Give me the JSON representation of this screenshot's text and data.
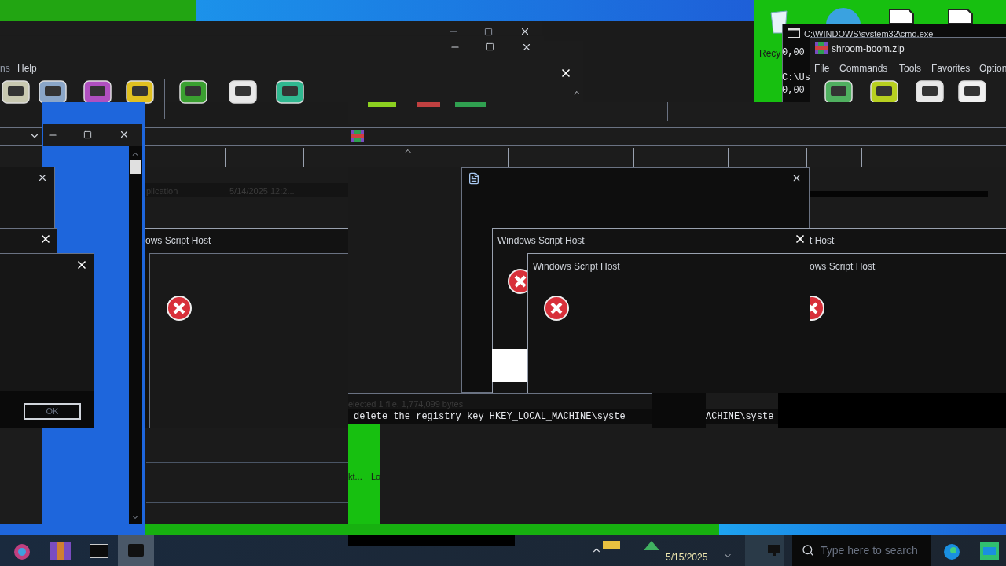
{
  "main_window": {
    "menu": [
      "ns",
      "Help"
    ]
  },
  "desktop_icons": [
    {
      "label": "Recy"
    }
  ],
  "cmd_window": {
    "title": "C:\\WINDOWS\\system32\\cmd.exe",
    "lines": [
      "0,00",
      "C:\\Us",
      "0,00"
    ]
  },
  "archive_window": {
    "title": "shroom-boom.zip",
    "menu": [
      "File",
      "Commands",
      "Tools",
      "Favorites",
      "Option"
    ]
  },
  "file_row": {
    "cells": [
      "plication",
      "5/14/2025 12:2..."
    ]
  },
  "dialogs": [
    {
      "title": "ows Script Host"
    },
    {
      "title": "Windows Script Host"
    },
    {
      "title": "Windows Script Host"
    },
    {
      "title": "t Host"
    },
    {
      "title": "ows Script Host"
    }
  ],
  "ok_button": "OK",
  "status_text": "elected 1 file, 1,774,099 bytes",
  "console_lines": [
    "delete the registry key HKEY_LOCAL_MACHINE\\syste",
    "ACHINE\\syste"
  ],
  "partial_texts": [
    "kt...",
    "Lo"
  ],
  "taskbar": {
    "date": "5/15/2025",
    "search": {
      "placeholder": "Type here to search"
    }
  }
}
